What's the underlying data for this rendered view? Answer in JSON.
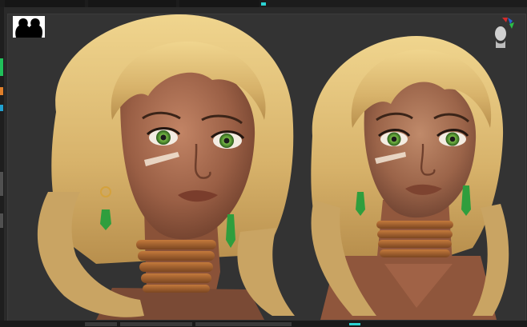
{
  "app": {
    "name": ""
  },
  "viewport": {
    "models": [
      {
        "name": ""
      },
      {
        "name": ""
      }
    ]
  },
  "ui_icons": {
    "document_thumbnail": "two-portraits-silhouette-icon",
    "orientation_gizmo": "head-axis-gizmo-icon"
  },
  "colors": {
    "background": "#2a2a2a",
    "viewport": "#333333",
    "accent": "#2bd3d3",
    "skin": "#a86a4c",
    "hair": "#d9b874",
    "eyes": "#6fb545",
    "earring_gem": "#2f9e3d",
    "collar": "#a5652f"
  }
}
